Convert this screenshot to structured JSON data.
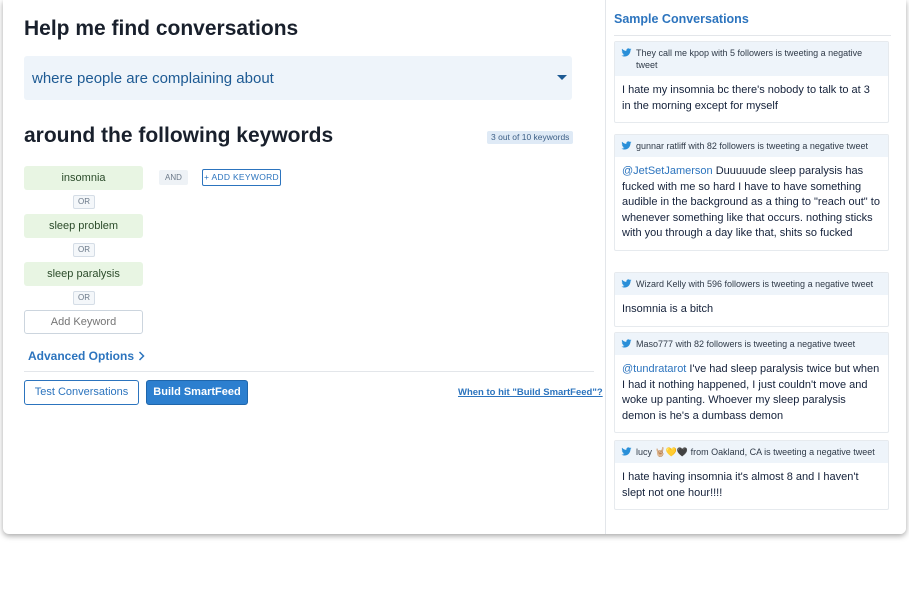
{
  "main": {
    "title": "Help me find conversations",
    "select_value": "where people are complaining about",
    "subtitle": "around the following keywords",
    "keyword_count": "3 out of 10 keywords",
    "keywords": [
      "insomnia",
      "sleep problem",
      "sleep paralysis"
    ],
    "or_label": "OR",
    "and_label": "AND",
    "add_keyword_button": "+ ADD KEYWORD",
    "add_keyword_placeholder": "Add Keyword",
    "advanced_options": "Advanced Options",
    "test_button": "Test Conversations",
    "build_button": "Build SmartFeed",
    "help_link": "When to hit \"Build SmartFeed\"?"
  },
  "sidebar": {
    "title": "Sample Conversations",
    "tweets": [
      {
        "header": "They call me kpop with 5 followers is tweeting a negative tweet",
        "body": "I hate my insomnia bc there's nobody to talk to at 3 in the morning except for myself"
      },
      {
        "header": "gunnar ratliff with 82 followers is tweeting a negative tweet",
        "mention": "@JetSetJamerson",
        "body": " Duuuuude sleep paralysis has fucked with me so hard I have to have something audible in the background as a thing to \"reach out\" to whenever something like that occurs. nothing sticks with you through a day like that, shits so fucked"
      },
      {
        "header": "Wizard Kelly with 596 followers is tweeting a negative tweet",
        "body": "Insomnia is a bitch"
      },
      {
        "header": "Maso777 with 82 followers is tweeting a negative tweet",
        "mention": "@tundratarot",
        "body": " I've had sleep paralysis twice but when I had it nothing happened, I just couldn't move and woke up panting. Whoever my sleep paralysis demon is he's a dumbass demon"
      },
      {
        "header": "lucy 🤘🏼💛🖤 from Oakland, CA is tweeting a negative tweet",
        "body": "I hate having insomnia it's almost 8 and I haven't slept not one hour!!!!"
      }
    ]
  },
  "colors": {
    "accent": "#2c74be",
    "keyword_bg": "#e8f5e3",
    "select_bg": "#eef4fa",
    "primary_button": "#2c7fcf"
  },
  "icons": {
    "tweet": "twitter-bird-icon",
    "select": "caret-down-icon",
    "advanced": "chevron-right-icon"
  }
}
